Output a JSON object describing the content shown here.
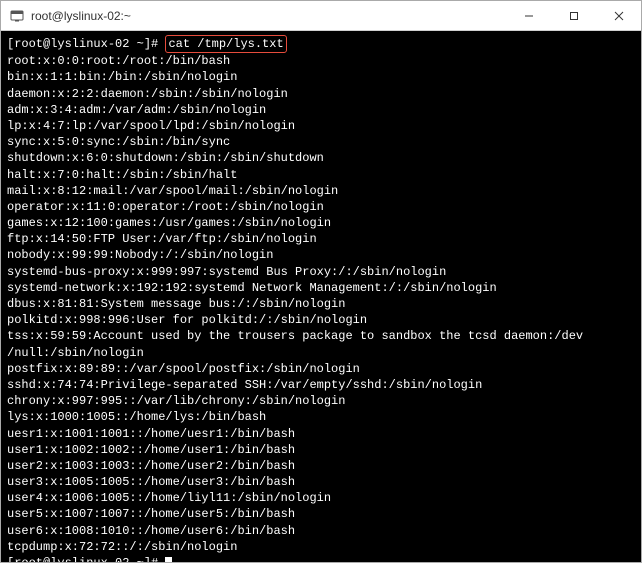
{
  "window": {
    "title": "root@lyslinux-02:~"
  },
  "terminal": {
    "prompt1": "[root@lyslinux-02 ~]# ",
    "command1": "cat /tmp/lys.txt",
    "output": [
      "root:x:0:0:root:/root:/bin/bash",
      "bin:x:1:1:bin:/bin:/sbin/nologin",
      "daemon:x:2:2:daemon:/sbin:/sbin/nologin",
      "adm:x:3:4:adm:/var/adm:/sbin/nologin",
      "lp:x:4:7:lp:/var/spool/lpd:/sbin/nologin",
      "sync:x:5:0:sync:/sbin:/bin/sync",
      "shutdown:x:6:0:shutdown:/sbin:/sbin/shutdown",
      "halt:x:7:0:halt:/sbin:/sbin/halt",
      "mail:x:8:12:mail:/var/spool/mail:/sbin/nologin",
      "operator:x:11:0:operator:/root:/sbin/nologin",
      "games:x:12:100:games:/usr/games:/sbin/nologin",
      "ftp:x:14:50:FTP User:/var/ftp:/sbin/nologin",
      "nobody:x:99:99:Nobody:/:/sbin/nologin",
      "systemd-bus-proxy:x:999:997:systemd Bus Proxy:/:/sbin/nologin",
      "systemd-network:x:192:192:systemd Network Management:/:/sbin/nologin",
      "dbus:x:81:81:System message bus:/:/sbin/nologin",
      "polkitd:x:998:996:User for polkitd:/:/sbin/nologin",
      "tss:x:59:59:Account used by the trousers package to sandbox the tcsd daemon:/dev",
      "/null:/sbin/nologin",
      "postfix:x:89:89::/var/spool/postfix:/sbin/nologin",
      "sshd:x:74:74:Privilege-separated SSH:/var/empty/sshd:/sbin/nologin",
      "chrony:x:997:995::/var/lib/chrony:/sbin/nologin",
      "lys:x:1000:1005::/home/lys:/bin/bash",
      "uesr1:x:1001:1001::/home/uesr1:/bin/bash",
      "user1:x:1002:1002::/home/user1:/bin/bash",
      "user2:x:1003:1003::/home/user2:/bin/bash",
      "user3:x:1005:1005::/home/user3:/bin/bash",
      "user4:x:1006:1005::/home/liyl11:/sbin/nologin",
      "user5:x:1007:1007::/home/user5:/bin/bash",
      "user6:x:1008:1010::/home/user6:/bin/bash",
      "tcpdump:x:72:72::/:/sbin/nologin"
    ],
    "prompt2": "[root@lyslinux-02 ~]# "
  }
}
